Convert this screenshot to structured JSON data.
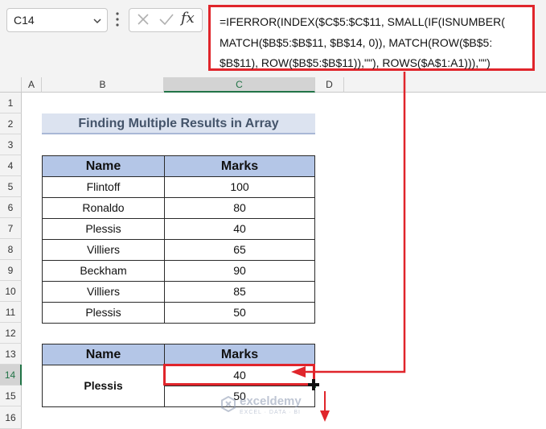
{
  "name_box": {
    "value": "C14"
  },
  "formula_bar": {
    "lines": [
      "=IFERROR(INDEX($C$5:$C$11, SMALL(IF(ISNUMBER(",
      "MATCH($B$5:$B$11, $B$14, 0)), MATCH(ROW($B$5:",
      "$B$11), ROW($B$5:$B$11)),\"\"), ROWS($A$1:A1))),\"\")"
    ],
    "fx_label": "fx"
  },
  "columns": [
    "A",
    "B",
    "C",
    "D"
  ],
  "selected_column": "C",
  "rows": [
    "1",
    "2",
    "3",
    "4",
    "5",
    "6",
    "7",
    "8",
    "9",
    "10",
    "11",
    "12",
    "13",
    "14",
    "15",
    "16"
  ],
  "selected_row": "14",
  "sheet_title": "Finding Multiple Results in Array",
  "table1": {
    "headers": [
      "Name",
      "Marks"
    ],
    "rows": [
      [
        "Flintoff",
        "100"
      ],
      [
        "Ronaldo",
        "80"
      ],
      [
        "Plessis",
        "40"
      ],
      [
        "Villiers",
        "65"
      ],
      [
        "Beckham",
        "90"
      ],
      [
        "Villiers",
        "85"
      ],
      [
        "Plessis",
        "50"
      ]
    ]
  },
  "table2": {
    "headers": [
      "Name",
      "Marks"
    ],
    "lookup_name": "Plessis",
    "results": [
      "40",
      "50"
    ]
  },
  "watermark": {
    "name": "exceldemy",
    "tagline": "EXCEL · DATA · BI"
  },
  "colors": {
    "accent_red": "#e0252b",
    "table_header": "#b4c6e7",
    "title_fill": "#dce3f0",
    "excel_green": "#217346"
  }
}
